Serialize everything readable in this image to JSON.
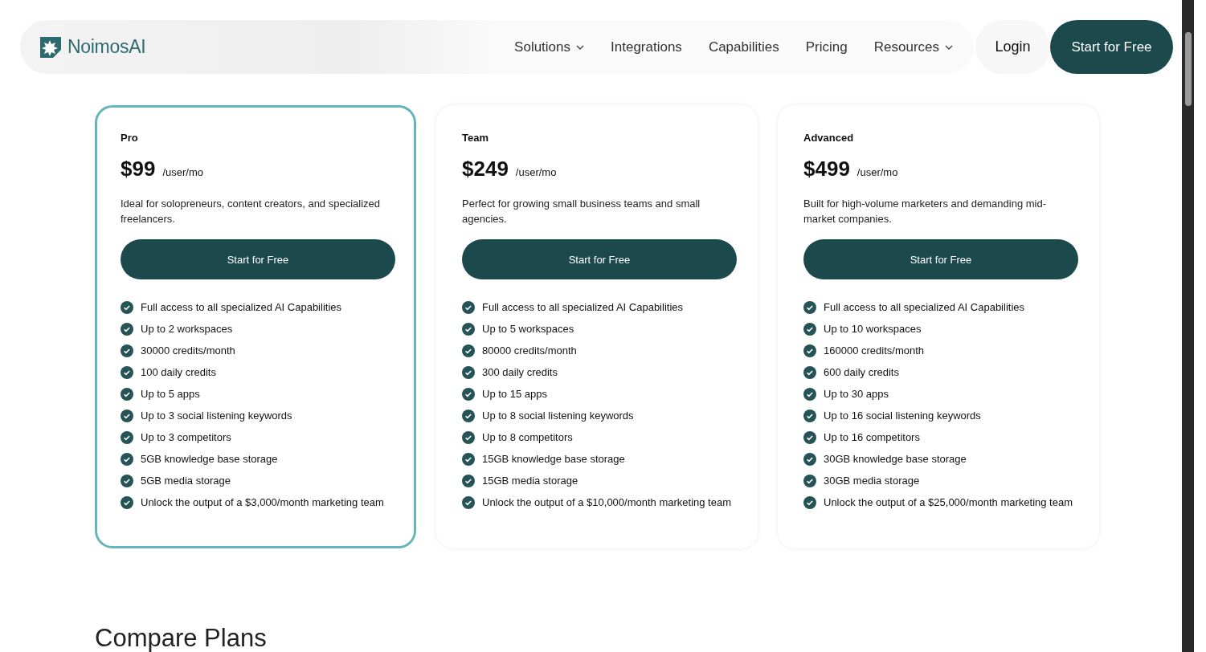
{
  "nav": {
    "brand": "NoimosAI",
    "links": [
      {
        "label": "Solutions",
        "dropdown": true
      },
      {
        "label": "Integrations",
        "dropdown": false
      },
      {
        "label": "Capabilities",
        "dropdown": false
      },
      {
        "label": "Pricing",
        "dropdown": false
      },
      {
        "label": "Resources",
        "dropdown": true
      }
    ],
    "login": "Login",
    "cta": "Start for Free"
  },
  "plans": [
    {
      "name": "Pro",
      "selected": true,
      "price": "$99",
      "unit": "/user/mo",
      "description": "Ideal for solopreneurs, content creators, and specialized freelancers.",
      "button": "Start for Free",
      "features": [
        "Full access to all specialized AI Capabilities",
        "Up to 2 workspaces",
        "30000 credits/month",
        "100 daily credits",
        "Up to 5 apps",
        "Up to 3 social listening keywords",
        "Up to 3 competitors",
        "5GB knowledge base storage",
        "5GB media storage",
        "Unlock the output of a $3,000/month marketing team"
      ]
    },
    {
      "name": "Team",
      "selected": false,
      "price": "$249",
      "unit": "/user/mo",
      "description": "Perfect for growing small business teams and small agencies.",
      "button": "Start for Free",
      "features": [
        "Full access to all specialized AI Capabilities",
        "Up to 5 workspaces",
        "80000 credits/month",
        "300 daily credits",
        "Up to 15 apps",
        "Up to 8 social listening keywords",
        "Up to 8 competitors",
        "15GB knowledge base storage",
        "15GB media storage",
        "Unlock the output of a $10,000/month marketing team"
      ]
    },
    {
      "name": "Advanced",
      "selected": false,
      "price": "$499",
      "unit": "/user/mo",
      "description": "Built for high-volume marketers and demanding mid-market companies.",
      "button": "Start for Free",
      "features": [
        "Full access to all specialized AI Capabilities",
        "Up to 10 workspaces",
        "160000 credits/month",
        "600 daily credits",
        "Up to 30 apps",
        "Up to 16 social listening keywords",
        "Up to 16 competitors",
        "30GB knowledge base storage",
        "30GB media storage",
        "Unlock the output of a $25,000/month marketing team"
      ]
    }
  ],
  "section_title": "Compare Plans"
}
